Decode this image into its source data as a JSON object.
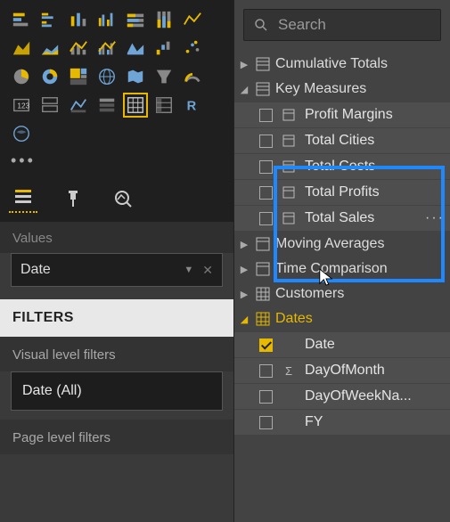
{
  "search": {
    "placeholder": "Search"
  },
  "left": {
    "values_label": "Values",
    "field_name": "Date",
    "filters_header": "FILTERS",
    "visual_filters_label": "Visual level filters",
    "visual_filter_card": "Date (All)",
    "page_filters_label": "Page level filters",
    "more": "•••"
  },
  "tree": {
    "nodes": [
      {
        "label": "Cumulative Totals"
      },
      {
        "label": "Key Measures"
      },
      {
        "label": "Moving Averages"
      },
      {
        "label": "Time Comparison"
      },
      {
        "label": "Customers"
      },
      {
        "label": "Dates"
      }
    ],
    "measures": [
      {
        "label": "Profit Margins"
      },
      {
        "label": "Total Cities"
      },
      {
        "label": "Total Costs"
      },
      {
        "label": "Total Profits"
      },
      {
        "label": "Total Sales"
      }
    ],
    "date_cols": [
      {
        "label": "Date"
      },
      {
        "label": "DayOfMonth"
      },
      {
        "label": "DayOfWeekNa..."
      },
      {
        "label": "FY"
      }
    ]
  },
  "colors": {
    "accent": "#e6b800",
    "select_blue": "#1e88ff"
  }
}
